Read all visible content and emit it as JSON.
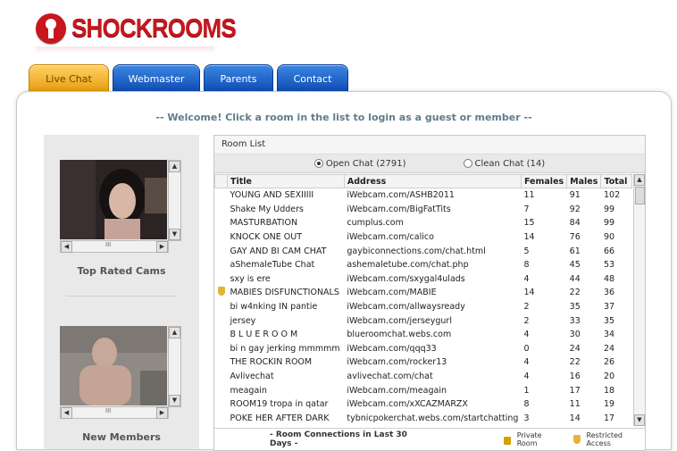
{
  "brand": {
    "name": "SHOCKROOMS"
  },
  "tabs": [
    {
      "label": "Live Chat",
      "active": true
    },
    {
      "label": "Webmaster"
    },
    {
      "label": "Parents"
    },
    {
      "label": "Contact"
    }
  ],
  "welcome": "-- Welcome! Click a room in the list to login as a guest or member --",
  "left": {
    "top_rated_label": "Top Rated Cams",
    "new_members_label": "New Members",
    "hscroll_label": "III"
  },
  "room_list": {
    "title": "Room List",
    "open_chat": "Open Chat (2791)",
    "clean_chat": "Clean Chat (14)",
    "columns": [
      "Title",
      "Address",
      "Females",
      "Males",
      "Total"
    ],
    "rows": [
      {
        "title": "YOUNG AND SEXIIIII",
        "address": "iWebcam.com/ASHB2011",
        "females": "11",
        "males": "91",
        "total": "102",
        "restricted": false
      },
      {
        "title": "Shake My Udders",
        "address": "iWebcam.com/BigFatTits",
        "females": "7",
        "males": "92",
        "total": "99",
        "restricted": false
      },
      {
        "title": "MASTURBATION",
        "address": "cumplus.com",
        "females": "15",
        "males": "84",
        "total": "99",
        "restricted": false
      },
      {
        "title": "KNOCK ONE OUT",
        "address": "iWebcam.com/calico",
        "females": "14",
        "males": "76",
        "total": "90",
        "restricted": false
      },
      {
        "title": "GAY AND BI CAM CHAT",
        "address": "gaybiconnections.com/chat.html",
        "females": "5",
        "males": "61",
        "total": "66",
        "restricted": false
      },
      {
        "title": "aShemaleTube Chat",
        "address": "ashemaletube.com/chat.php",
        "females": "8",
        "males": "45",
        "total": "53",
        "restricted": false
      },
      {
        "title": "sxy is ere",
        "address": "iWebcam.com/sxygal4ulads",
        "females": "4",
        "males": "44",
        "total": "48",
        "restricted": false
      },
      {
        "title": "MABIES DISFUNCTIONALS",
        "address": "iWebcam.com/MABIE",
        "females": "14",
        "males": "22",
        "total": "36",
        "restricted": true
      },
      {
        "title": "bi w4nking IN pantie",
        "address": "iWebcam.com/allwaysready",
        "females": "2",
        "males": "35",
        "total": "37",
        "restricted": false
      },
      {
        "title": "jersey",
        "address": "iWebcam.com/jerseygurl",
        "females": "2",
        "males": "33",
        "total": "35",
        "restricted": false
      },
      {
        "title": "B L U E R O O M",
        "address": "blueroomchat.webs.com",
        "females": "4",
        "males": "30",
        "total": "34",
        "restricted": false
      },
      {
        "title": "bi n gay jerking mmmmm",
        "address": "iWebcam.com/qqq33",
        "females": "0",
        "males": "24",
        "total": "24",
        "restricted": false
      },
      {
        "title": "THE ROCKIN ROOM",
        "address": "iWebcam.com/rocker13",
        "females": "4",
        "males": "22",
        "total": "26",
        "restricted": false
      },
      {
        "title": "Avlivechat",
        "address": "avlivechat.com/chat",
        "females": "4",
        "males": "16",
        "total": "20",
        "restricted": false
      },
      {
        "title": "meagain",
        "address": "iWebcam.com/meagain",
        "females": "1",
        "males": "17",
        "total": "18",
        "restricted": false
      },
      {
        "title": "ROOM19 tropa in qatar",
        "address": "iWebcam.com/xXCAZMARZX",
        "females": "8",
        "males": "11",
        "total": "19",
        "restricted": false
      },
      {
        "title": "POKE HER AFTER DARK",
        "address": "tybnicpokerchat.webs.com/startchatting",
        "females": "3",
        "males": "14",
        "total": "17",
        "restricted": false
      }
    ],
    "footer": {
      "connections": "- Room Connections in Last 30 Days -",
      "private_room": "Private Room",
      "restricted_access": "Restricted Access"
    }
  }
}
